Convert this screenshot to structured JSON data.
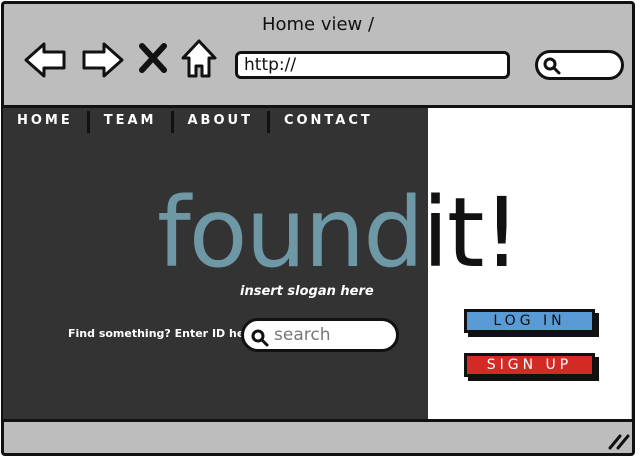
{
  "window": {
    "title": "Home view /"
  },
  "toolbar": {
    "back_icon": "back-arrow-icon",
    "forward_icon": "forward-arrow-icon",
    "stop_icon": "close-x-icon",
    "home_icon": "home-icon",
    "url": "http://",
    "search_icon": "search-icon"
  },
  "menu": {
    "items": [
      {
        "label": "HOME"
      },
      {
        "label": "TEAM"
      },
      {
        "label": "ABOUT"
      },
      {
        "label": "CONTACT"
      }
    ]
  },
  "hero": {
    "logo_part1": "found",
    "logo_part2": "it!",
    "slogan": "insert slogan here",
    "find_label": "Find something? Enter ID here",
    "search_placeholder": "search"
  },
  "actions": {
    "login_label": "LOG IN",
    "signup_label": "SIGN UP"
  },
  "colors": {
    "logo_accent": "#6e98a6",
    "login_bg": "#5b9bd5",
    "signup_bg": "#d42a26",
    "dark_panel": "#333333"
  }
}
